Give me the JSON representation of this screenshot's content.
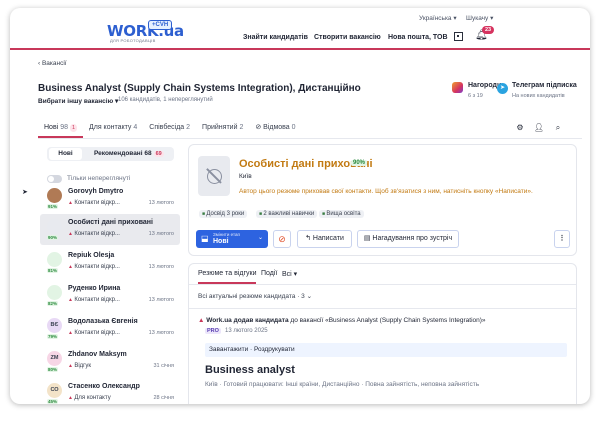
{
  "header": {
    "logo": "WORK",
    "logo_tld": ".ua",
    "logo_badge": "+CVH",
    "logo_sub": "ДЛЯ РОБОТОДАВЦІВ",
    "language": "Українська ▾",
    "seeker": "Шукачу ▾",
    "nav": [
      "Знайти кандидатів",
      "Створити вакансію",
      "Нова пошта, ТОВ"
    ],
    "notifications": "23"
  },
  "breadcrumb": "‹  Вакансії",
  "vacancy": {
    "title": "Business Analyst (Supply Chain Systems Integration), Дистанційно",
    "choose_label": "Вибрати іншу вакансію ▾",
    "counts": "106 кандидатів, 1 непереглянутий"
  },
  "widgets": {
    "rewards_title": "Нагороди",
    "rewards_sub": "6 з 19",
    "telegram_title": "Телеграм підписка",
    "telegram_sub": "На нових кандидатів"
  },
  "tabs": [
    {
      "label": "Нові",
      "count": "98",
      "badge": "1"
    },
    {
      "label": "Для контакту",
      "count": "4"
    },
    {
      "label": "Співбесіда",
      "count": "2"
    },
    {
      "label": "Прийнятий",
      "count": "2"
    },
    {
      "label": "Відмова",
      "count": "0"
    }
  ],
  "sidebar": {
    "seg_new": "Нові",
    "seg_rec": "Рекомендовані 68",
    "seg_rec_badge": "69",
    "toggle_label": "Тільки непереглянуті",
    "candidates": [
      {
        "initials": "",
        "name": "Gorovyh Dmytro",
        "status": "Контакти відкр...",
        "date": "13 лютого",
        "pct": "91%",
        "color": "#b07a55"
      },
      {
        "initials": "",
        "name": "Особисті дані приховані",
        "status": "Контакти відкр...",
        "date": "13 лютого",
        "pct": "90%",
        "color": "#e8eaef"
      },
      {
        "initials": "",
        "name": "Repiuk Olesja",
        "status": "Контакти відкр...",
        "date": "13 лютого",
        "pct": "81%",
        "color": "#e2f4e4"
      },
      {
        "initials": "",
        "name": "Руденко Ирина",
        "status": "Контакти відкр...",
        "date": "13 лютого",
        "pct": "82%",
        "color": "#e2f4e4"
      },
      {
        "initials": "ВЄ",
        "name": "Водолазька Євгенія",
        "status": "Контакти відкр...",
        "date": "13 лютого",
        "pct": "79%",
        "color": "#e8d9f5"
      },
      {
        "initials": "ZM",
        "name": "Zhdanov Maksym",
        "status": "Відгук",
        "date": "31 січня",
        "pct": "80%",
        "color": "#f7d6e6"
      },
      {
        "initials": "СО",
        "name": "Стасенко Олександр",
        "status": "Для контакту",
        "date": "28 січня",
        "pct": "45%",
        "color": "#f3e3c8"
      }
    ]
  },
  "profile": {
    "hidden_title": "Особисті дані приховані",
    "match": "90%",
    "city": "Київ",
    "note": "Автор цього резюме приховав свої контакти. Щоб зв'язатися з ним, натисніть кнопку «Написати».",
    "chips": [
      "Досвід 3 роки",
      "2 важливі навички",
      "Вища освіта"
    ],
    "move_small": "Змінити етап",
    "move_value": "Нові",
    "write": "↰  Написати",
    "remind": "▤  Нагадування про зустріч",
    "more": "⋮"
  },
  "resume": {
    "tabs": [
      "Резюме та відгуки",
      "Події",
      "Всі ▾"
    ],
    "all_resumes": "Всі актуальні резюме кандидата · 3  ⌄",
    "event_bold": "Work.ua додав кандидата",
    "event_rest": " до вакансії «Business Analyst (Supply Chain Systems Integration)»",
    "pro": "PRO",
    "event_date": "13 лютого 2025",
    "download": "Завантажити · Роздрукувати",
    "title": "Business analyst",
    "meta": "Київ · Готовий працювати: Інші країни, Дистанційно · Повна зайнятість, неповна зайнятість"
  },
  "colors": {
    "accent": "#c8385a",
    "primary": "#2d63e0",
    "warning": "#c27a12"
  }
}
